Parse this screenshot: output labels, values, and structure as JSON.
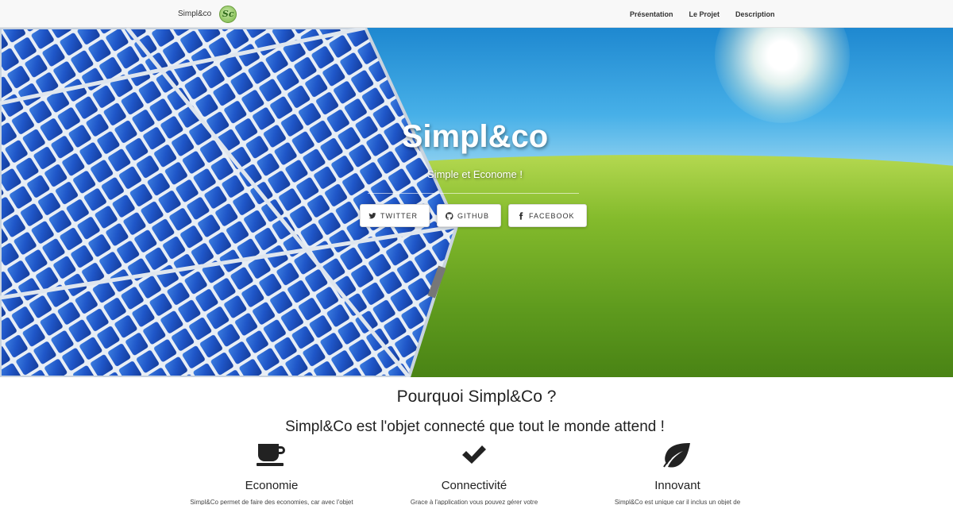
{
  "navbar": {
    "brand": "Simpl&co",
    "logo_text": "Sc",
    "links": [
      "Présentation",
      "Le Projet",
      "Description"
    ]
  },
  "hero": {
    "title": "Simpl&co",
    "subtitle": "Simple et Econome !",
    "buttons": [
      {
        "label": "TWITTER",
        "icon": "twitter-icon"
      },
      {
        "label": "GITHUB",
        "icon": "github-icon"
      },
      {
        "label": "FACEBOOK",
        "icon": "facebook-icon"
      }
    ]
  },
  "content": {
    "heading": "Pourquoi Simpl&Co ?",
    "subheading": "Simpl&Co est l'objet connecté que tout le monde attend !",
    "features": [
      {
        "icon": "coffee-cup-icon",
        "title": "Economie",
        "text": "Simpl&Co permet de faire des economies, car avec l'objet"
      },
      {
        "icon": "checkmark-icon",
        "title": "Connectivité",
        "text": "Grace à l'application vous pouvez gérer votre"
      },
      {
        "icon": "leaf-icon",
        "title": "Innovant",
        "text": "Simpl&Co est unique car il inclus un objet de"
      }
    ]
  },
  "colors": {
    "sky": "#47b0e8",
    "grass": "#5f9b1e",
    "panel": "#1d4fc2",
    "navbar_bg": "#f8f8f8"
  }
}
